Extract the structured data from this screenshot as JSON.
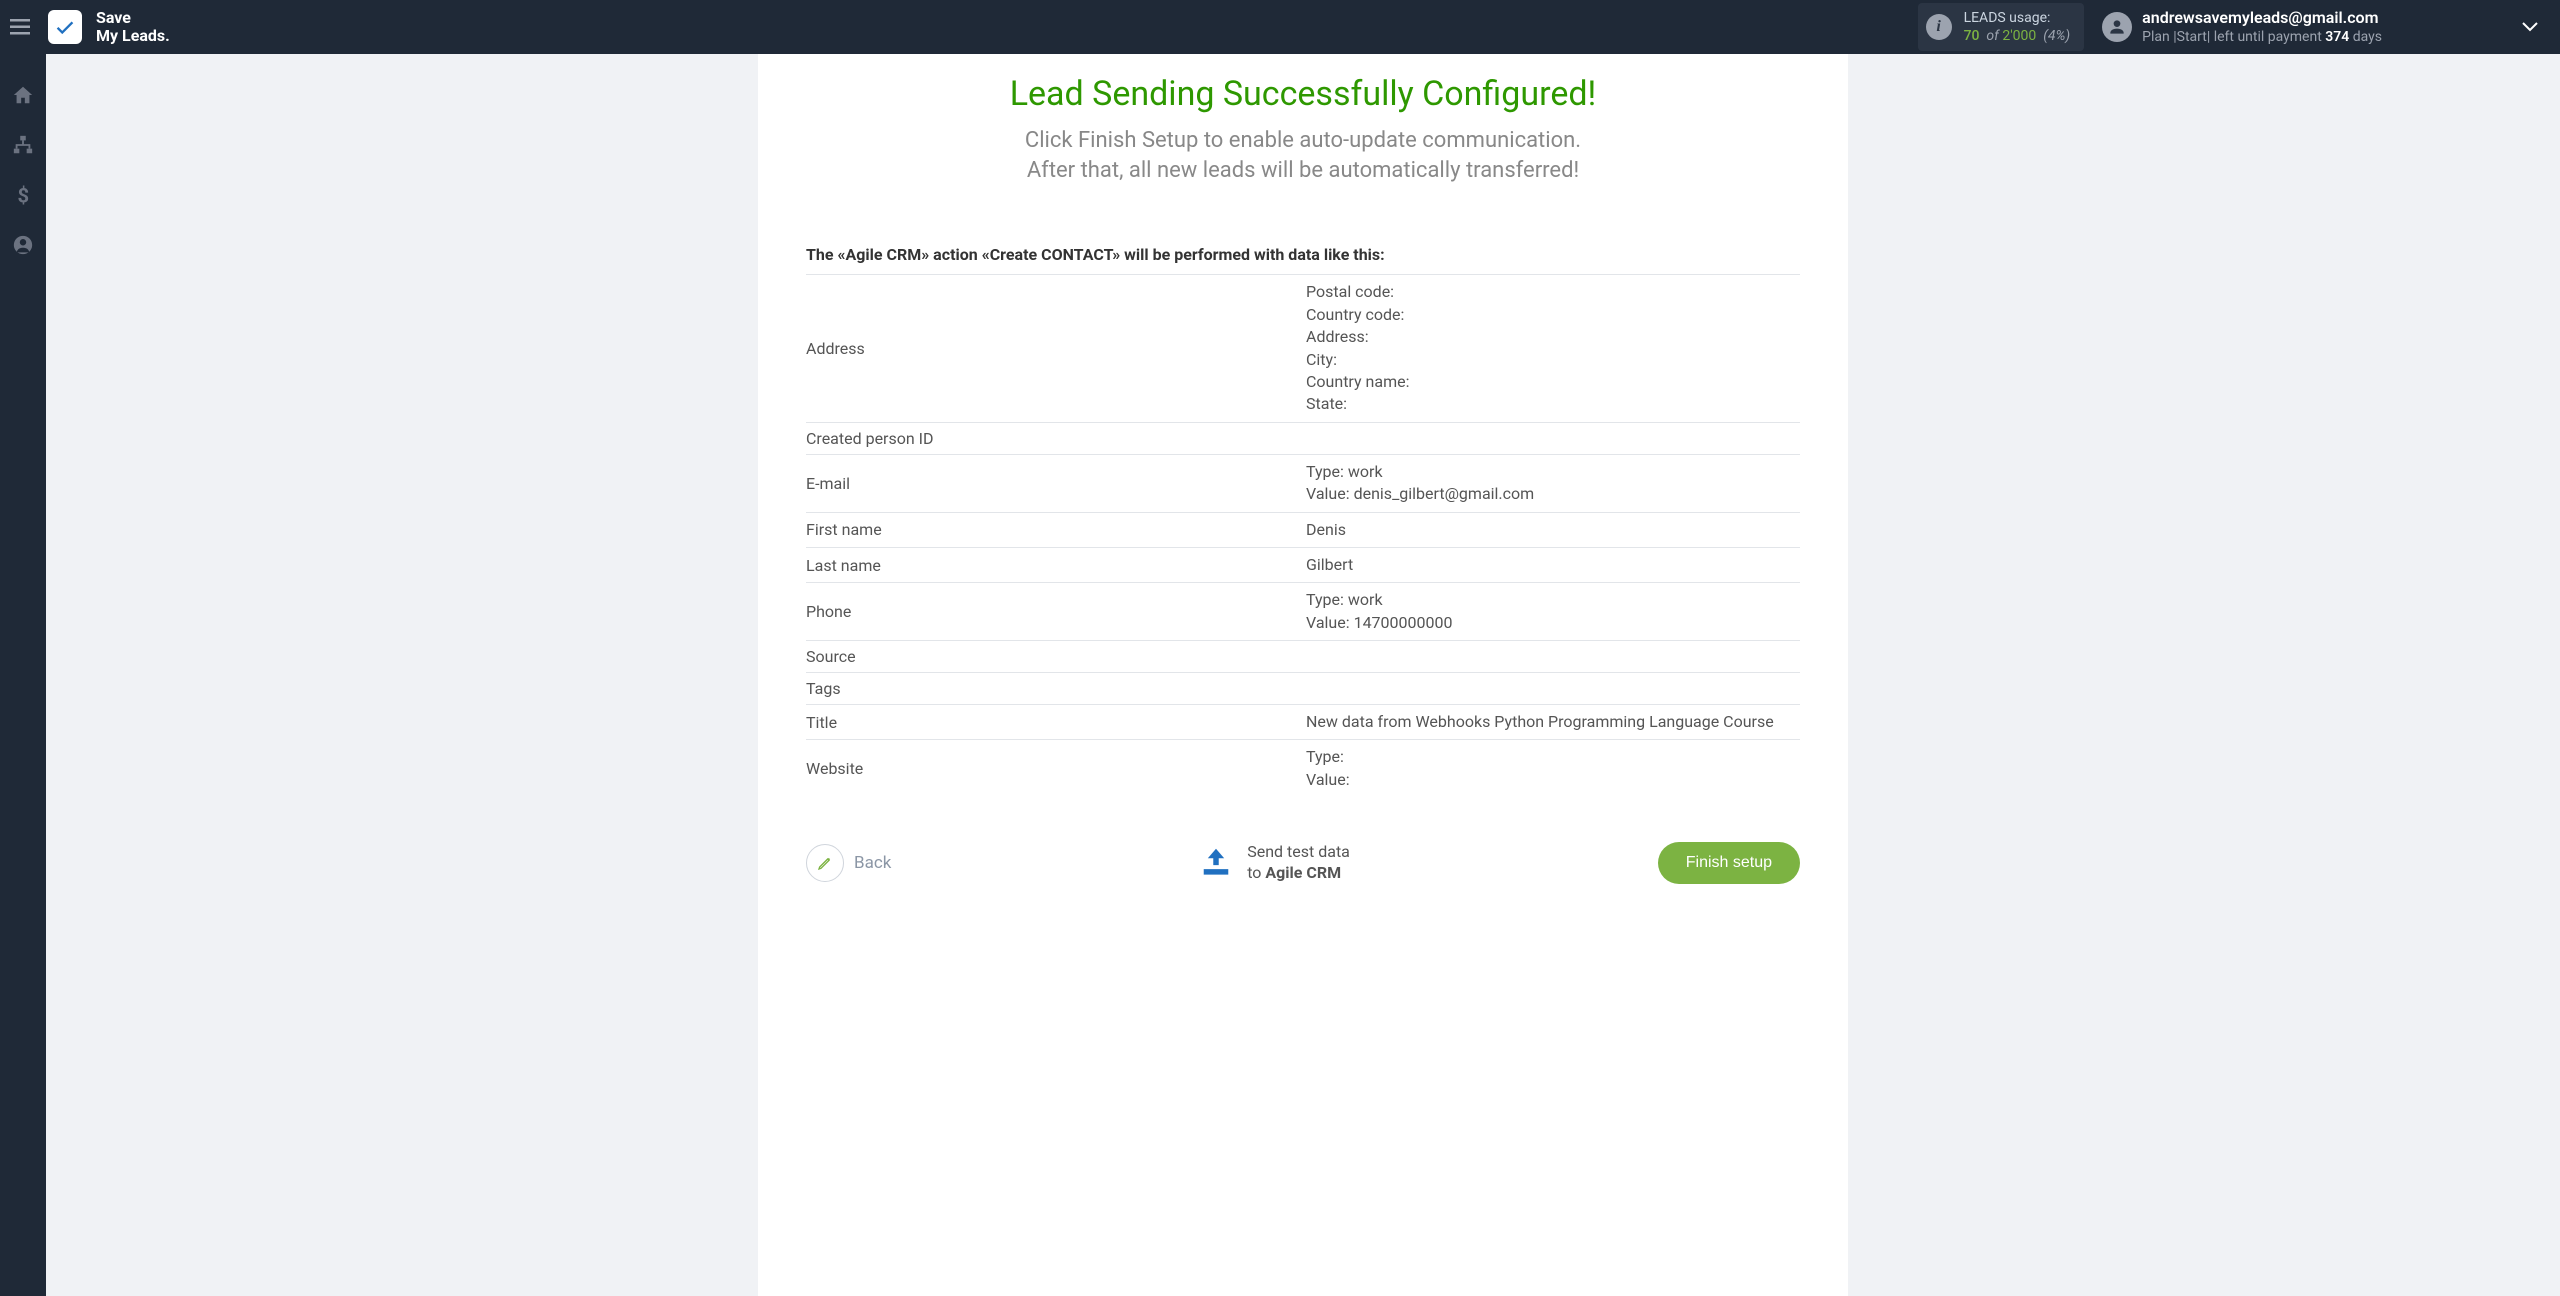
{
  "header": {
    "logo_text": "Save\nMy Leads.",
    "usage_label": "LEADS usage:",
    "usage_value": "70",
    "usage_of": "of",
    "usage_limit": "2'000",
    "usage_pct": "(4%)",
    "user_email": "andrewsavemyleads@gmail.com",
    "plan_prefix": "Plan |Start| left until payment ",
    "plan_days": "374",
    "plan_suffix": " days"
  },
  "main": {
    "success_title": "Lead Sending Successfully Configured!",
    "success_subtitle_l1": "Click Finish Setup to enable auto-update communication.",
    "success_subtitle_l2": "After that, all new leads will be automatically transferred!",
    "action_desc": "The «Agile CRM» action «Create CONTACT» will be performed with data like this:",
    "rows": [
      {
        "label": "Address",
        "lines": [
          "Postal code:",
          "Country code:",
          "Address:",
          "City:",
          "Country name:",
          "State:"
        ]
      },
      {
        "label": "Created person ID",
        "lines": []
      },
      {
        "label": "E-mail",
        "lines": [
          "Type: work",
          "Value: denis_gilbert@gmail.com"
        ]
      },
      {
        "label": "First name",
        "lines": [
          "Denis"
        ]
      },
      {
        "label": "Last name",
        "lines": [
          "Gilbert"
        ]
      },
      {
        "label": "Phone",
        "lines": [
          "Type: work",
          "Value: 14700000000"
        ]
      },
      {
        "label": "Source",
        "lines": []
      },
      {
        "label": "Tags",
        "lines": []
      },
      {
        "label": "Title",
        "lines": [
          "New data from Webhooks Python Programming Language Course"
        ]
      },
      {
        "label": "Website",
        "lines": [
          "Type:",
          "Value:"
        ]
      }
    ]
  },
  "footer": {
    "back_label": "Back",
    "send_test_l1": "Send test data",
    "send_test_l2_prefix": "to ",
    "send_test_target": "Agile CRM",
    "finish_label": "Finish setup"
  }
}
